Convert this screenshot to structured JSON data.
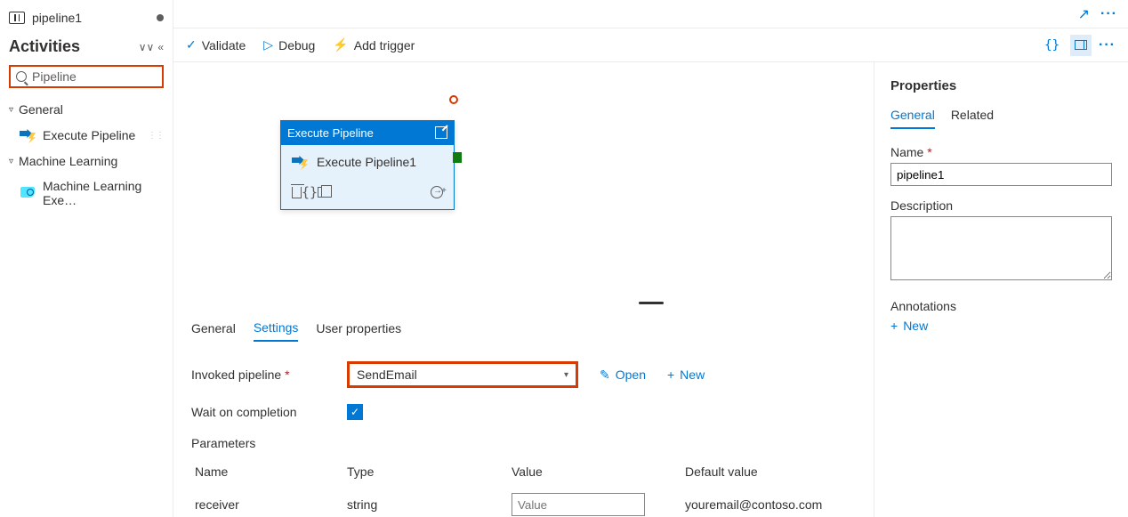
{
  "breadcrumb": {
    "title": "pipeline1"
  },
  "sidebar": {
    "title": "Activities",
    "search": "Pipeline",
    "categories": [
      {
        "name": "General",
        "items": [
          {
            "label": "Execute Pipeline"
          }
        ]
      },
      {
        "name": "Machine Learning",
        "items": [
          {
            "label": "Machine Learning Exe…"
          }
        ]
      }
    ]
  },
  "toolbar": {
    "validate": "Validate",
    "debug": "Debug",
    "trigger": "Add trigger"
  },
  "canvas": {
    "node": {
      "type_label": "Execute Pipeline",
      "name": "Execute Pipeline1"
    }
  },
  "details": {
    "tabs": {
      "general": "General",
      "settings": "Settings",
      "user": "User properties"
    },
    "invoked_label": "Invoked pipeline",
    "invoked_value": "SendEmail",
    "open_label": "Open",
    "new_label": "New",
    "wait_label": "Wait on completion",
    "params_label": "Parameters",
    "headers": {
      "name": "Name",
      "type": "Type",
      "value": "Value",
      "default": "Default value"
    },
    "rows": [
      {
        "name": "receiver",
        "type": "string",
        "value_placeholder": "Value",
        "default": "youremail@contoso.com"
      }
    ]
  },
  "properties": {
    "title": "Properties",
    "tabs": {
      "general": "General",
      "related": "Related"
    },
    "name_label": "Name",
    "name_value": "pipeline1",
    "desc_label": "Description",
    "annotations_label": "Annotations",
    "new_label": "New"
  }
}
